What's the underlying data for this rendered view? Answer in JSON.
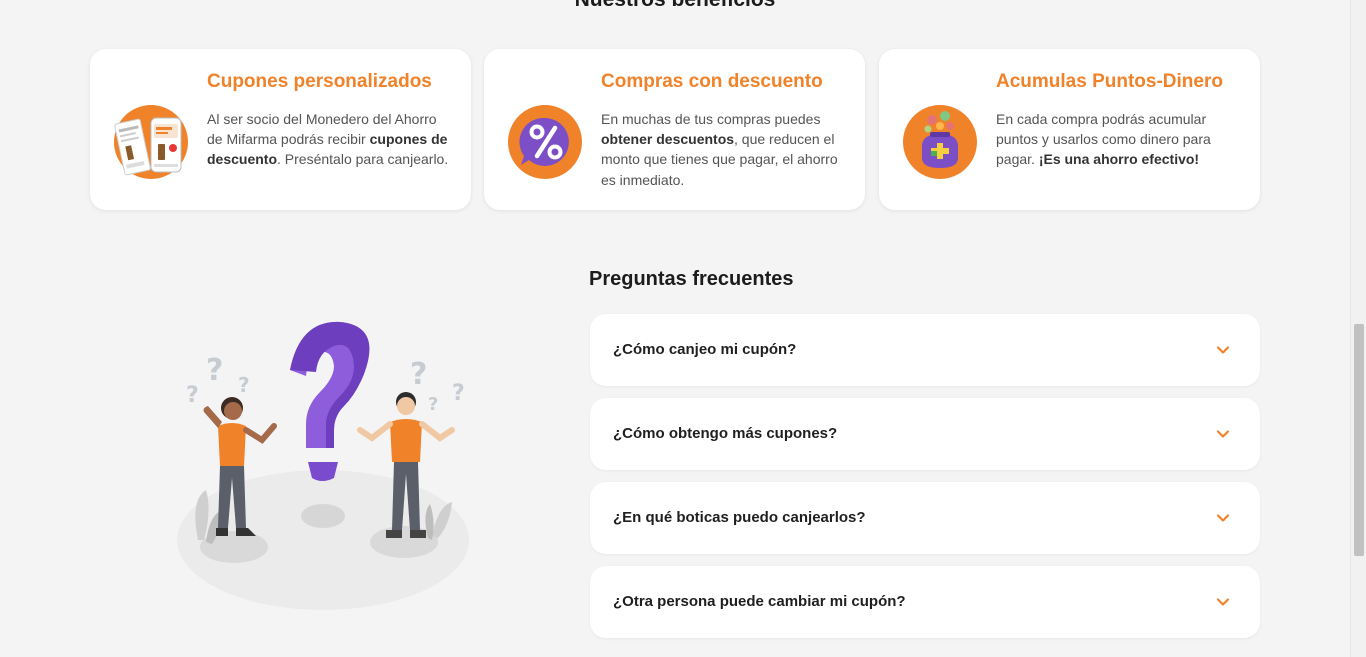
{
  "benefits": {
    "title": "Nuestros beneficios",
    "cards": [
      {
        "title": "Cupones personalizados",
        "desc_parts": [
          "Al ser socio del Monedero del Ahorro de Mifarma podrás recibir ",
          "cupones de descuento",
          ". Preséntalo para canjearlo."
        ],
        "icon": "coupons-icon"
      },
      {
        "title": "Compras con descuento",
        "desc_parts": [
          "En muchas de tus compras puedes ",
          "obtener descuentos",
          ", que reducen el monto que tienes que pagar, el ahorro es inmediato."
        ],
        "icon": "percent-icon"
      },
      {
        "title": "Acumulas Puntos-Dinero",
        "desc_parts": [
          "En cada compra podrás acumular puntos y usarlos como dinero para pagar. ",
          "¡Es una ahorro efectivo!",
          ""
        ],
        "icon": "piggy-bank-icon"
      }
    ]
  },
  "faq": {
    "title": "Preguntas frecuentes",
    "items": [
      {
        "question": "¿Cómo canjeo mi cupón?"
      },
      {
        "question": "¿Cómo obtengo más cupones?"
      },
      {
        "question": "¿En qué boticas puedo canjearlos?"
      },
      {
        "question": "¿Otra persona puede cambiar mi cupón?"
      }
    ]
  },
  "colors": {
    "accent": "#f0822a",
    "purple": "#7d4fc7",
    "background": "#f4f4f4"
  }
}
